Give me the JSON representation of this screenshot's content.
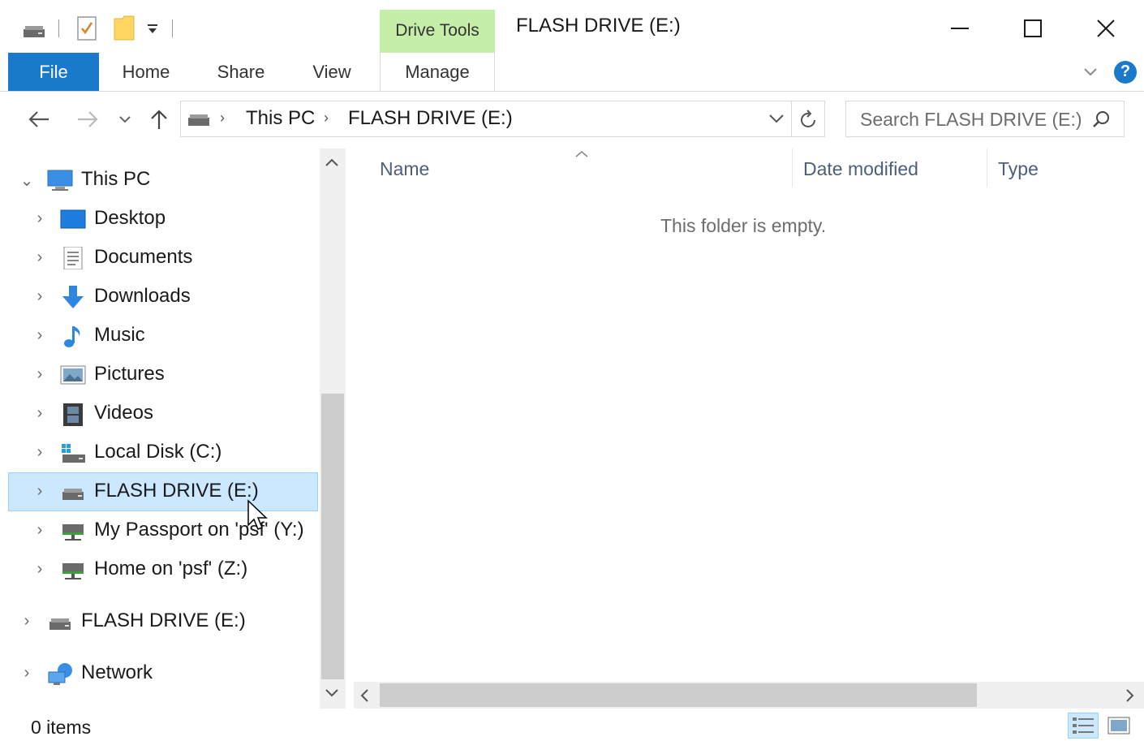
{
  "titlebar": {
    "title": "FLASH DRIVE (E:)",
    "contextual_tab": "Drive Tools",
    "minimize": "—",
    "maximize": "☐",
    "close": "✕"
  },
  "ribbon": {
    "tabs": [
      {
        "label": "File"
      },
      {
        "label": "Home"
      },
      {
        "label": "Share"
      },
      {
        "label": "View"
      },
      {
        "label": "Manage"
      }
    ],
    "help": "?"
  },
  "address": {
    "crumbs": [
      "This PC",
      "FLASH DRIVE (E:)"
    ],
    "search_placeholder": "Search FLASH DRIVE (E:)"
  },
  "navpane": {
    "items": [
      {
        "label": "This PC",
        "icon": "pc-icon",
        "expanded": true
      },
      {
        "label": "Desktop",
        "icon": "desktop-icon"
      },
      {
        "label": "Documents",
        "icon": "documents-icon"
      },
      {
        "label": "Downloads",
        "icon": "downloads-icon"
      },
      {
        "label": "Music",
        "icon": "music-icon"
      },
      {
        "label": "Pictures",
        "icon": "pictures-icon"
      },
      {
        "label": "Videos",
        "icon": "videos-icon"
      },
      {
        "label": "Local Disk (C:)",
        "icon": "local-disk-icon"
      },
      {
        "label": "FLASH DRIVE (E:)",
        "icon": "drive-icon",
        "selected": true
      },
      {
        "label": "My Passport on 'psf' (Y:)",
        "icon": "network-drive-icon"
      },
      {
        "label": "Home on 'psf' (Z:)",
        "icon": "network-drive-icon"
      },
      {
        "label": "FLASH DRIVE (E:)",
        "icon": "drive-icon"
      },
      {
        "label": "Network",
        "icon": "network-icon"
      }
    ]
  },
  "content": {
    "columns": [
      "Name",
      "Date modified",
      "Type"
    ],
    "empty_message": "This folder is empty."
  },
  "status": {
    "items_count": "0 items"
  },
  "colors": {
    "file_tab": "#1979ca",
    "drive_tools": "#c5efa9",
    "selection": "#cce8ff",
    "selection_border": "#99d1ff",
    "header_text": "#4c607a"
  }
}
